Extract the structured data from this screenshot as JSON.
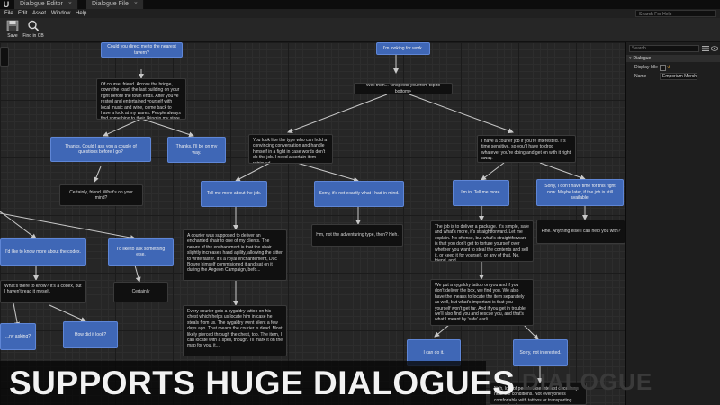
{
  "tabs": [
    {
      "label": "Dialogue Editor"
    },
    {
      "label": "Dialogue File"
    }
  ],
  "menu": [
    "File",
    "Edit",
    "Asset",
    "Window",
    "Help"
  ],
  "help_search_placeholder": "Search For Help",
  "toolbar": {
    "save_label": "Save",
    "find_label": "Find in CB"
  },
  "details": {
    "search_placeholder": "Search",
    "section": "Dialogue",
    "display_idle_label": "Display Idle",
    "name_label": "Name",
    "name_value": "Emporium Merchant"
  },
  "nodes": {
    "n1": "Could you direct me to the nearest tavern?",
    "n2": "I'm looking for work.",
    "n3": "Of course, friend. Across the bridge, down the road, the last building on your right before the town ends. After you've rested and entertained yourself with local music and wine, come back to have a look at my wares. People always find something to their liking in my store. They always do.",
    "n4": "Well then... <inspects you from top to bottom>",
    "n5": "Thanks. Could I ask you a couple of questions before I go?",
    "n6": "Thanks, I'll be on my way.",
    "n7": "You look like the type who can hold a convincing conversation and handle himself in a fight in case words don't do the job. I need a certain item retrieved.",
    "n8": "I have a courier job if you're interested. It's time sensitive, so you'll have to drop whatever you're doing and get on with it right away.",
    "n9": "Certainly, friend. What's on your mind?",
    "n10": "Tell me more about the job.",
    "n11": "Sorry, it's not exactly what I had in mind.",
    "n12": "I'm in. Tell me more.",
    "n13": "Sorry, I don't have time for this right now. Maybe later, if the job is still available.",
    "n14": "I'd like to know more about the codex.",
    "n15": "I'd like to ask something else.",
    "n16": "Hm, not the adventuring type, then? Heh.",
    "n17": "Fine. Anything else I can help you with?",
    "n18": "A courier was supposed to deliver an enchanted chair to one of my clients. The nature of the enchantment is that the chair slightly increases hand agility, allowing the sitter to write faster. It's a royal enchantement, Duc Bowre himself commisioned it and sat on it during the Aegeon Campaign, befo...",
    "n19": "The job is to deliver a package. It's simple, safe and what's more, it's straightforward. Let me explain. No offense, but what's straightforward is that you don't get to torture yourself over whether you want to steal the contents and sell it, or keep it for yourself, or any of that. No, friend, and...",
    "n20": "What's there to know? It's a codex, but I haven't read it myself.",
    "n21": "Certainly",
    "n22": "We put a sygaldry tattoo on you and if you don't deliver the box, we find you. We also have the means to locate the item separately as well, but what's important is that you yourself won't get far. And if you get in trouble, we'll also find you and rescue you, and that's what I meant by 'safe' earli...",
    "n23": "How did it look?",
    "n24": "Every courier gets a sygaldry tattoo on his chest which helps us locate him in case he steals from us. The sygaldry went silent a few days ago. That means the courier is dead. Most likely pierced through the chest, too. The item, I can locate with a spell, though. I'll mark it on the map for you, it...",
    "n25": "I can do it.",
    "n26": "Sorry, not interested.",
    "n27": "...ny asking?",
    "n28": "Nah, lots of people lose interest once they hear the conditions. Not everyone is comfortable with tattoos or transporting expensive items."
  },
  "banner_text": "SUPPORTS HUGE DIALOGUES",
  "watermark_text": "DIALOGUE",
  "colors": {
    "player_node": "#3f67b6",
    "npc_node": "#101010",
    "wire": "#c8c8c8",
    "accent_reset": "#d9a23c"
  }
}
